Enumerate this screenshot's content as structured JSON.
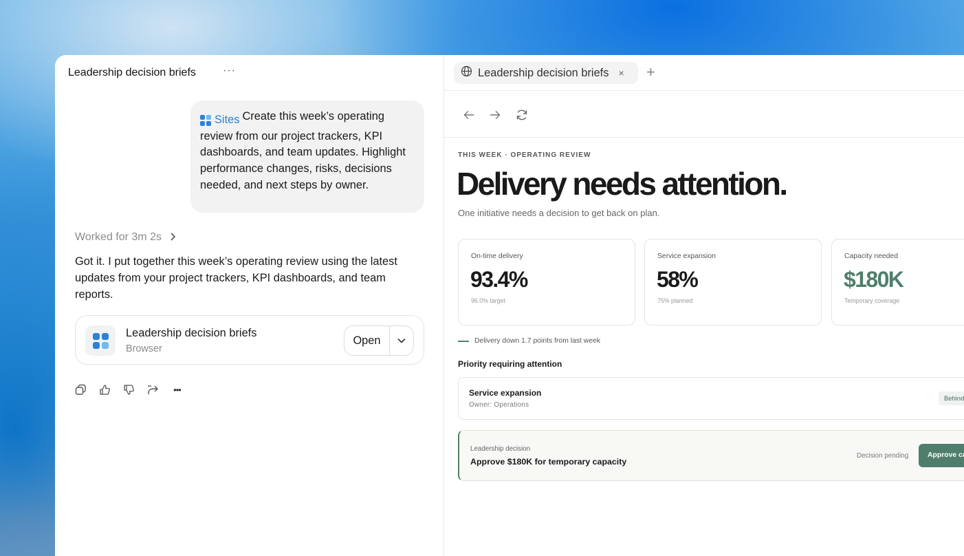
{
  "chat": {
    "title": "Leadership decision briefs",
    "more_label": "···",
    "prompt": {
      "tag": "Sites",
      "text": "Create this week’s operating review from our project trackers, KPI dashboards, and team updates. Highlight performance changes, risks, decisions needed, and next steps by owner."
    },
    "worked_for": "Worked for 3m 2s",
    "reply": "Got it. I put together this week’s operating review using the latest updates from your project trackers, KPI dashboards, and team reports.",
    "artifact": {
      "title": "Leadership decision briefs",
      "subtitle": "Browser",
      "open_label": "Open"
    },
    "action_icons": [
      "copy-icon",
      "thumbs-up-icon",
      "thumbs-down-icon",
      "share-icon",
      "more-icon"
    ],
    "action_more_label": "•••"
  },
  "browser": {
    "tab_title": "Leadership decision briefs",
    "tab_close": "×",
    "tab_add": "+"
  },
  "page": {
    "eyebrow": "THIS WEEK · OPERATING REVIEW",
    "headline": "Delivery needs attention.",
    "subhead": "One initiative needs a decision to get back on plan.",
    "kpis": [
      {
        "label": "On-time delivery",
        "value": "93.4%",
        "note": "96.0% target"
      },
      {
        "label": "Service expansion",
        "value": "58%",
        "note": "75% planned"
      },
      {
        "label": "Capacity needed",
        "value": "$180K",
        "note": "Temporary coverage"
      }
    ],
    "trend_note": "Delivery down 1.7 points from last week",
    "priority_section": "Priority requiring attention",
    "priority": {
      "title": "Service expansion",
      "owner": "Owner: Operations",
      "status": "Behind"
    },
    "decision": {
      "label": "Leadership decision",
      "title": "Approve $180K for temporary capacity",
      "status": "Decision pending",
      "button": "Approve capacity"
    }
  },
  "colors": {
    "accent_green": "#4f7f6c",
    "sites_blue": "#2b82d9"
  }
}
